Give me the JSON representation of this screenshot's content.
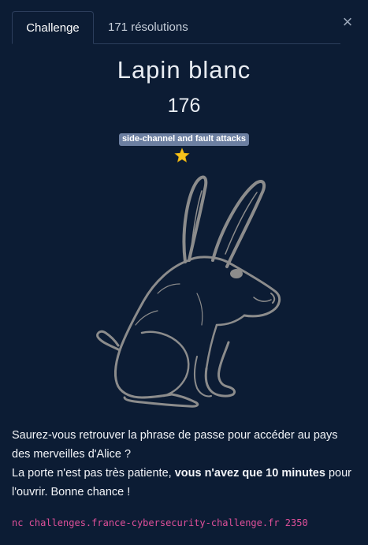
{
  "tabs": {
    "challenge_label": "Challenge",
    "solves_label": "171 résolutions"
  },
  "close_label": "×",
  "challenge": {
    "title": "Lapin blanc",
    "points": "176",
    "category": "side-channel and fault attacks",
    "difficulty_stars": 1,
    "image_icon": "white-rabbit-illustration"
  },
  "description": {
    "line1": "Saurez-vous retrouver la phrase de passe pour accéder au pays des merveilles d'Alice ?",
    "line2_start": "La porte n'est pas très patiente, ",
    "line2_bold": "vous n'avez que 10 minutes",
    "line2_end": " pour l'ouvrir. Bonne chance !"
  },
  "command": "nc challenges.france-cybersecurity-challenge.fr 2350",
  "colors": {
    "background": "#0c1c34",
    "badge": "#6c7fa1",
    "star": "#f6c21c",
    "command": "#e0509a",
    "rabbit_line": "#8c8c8c"
  }
}
